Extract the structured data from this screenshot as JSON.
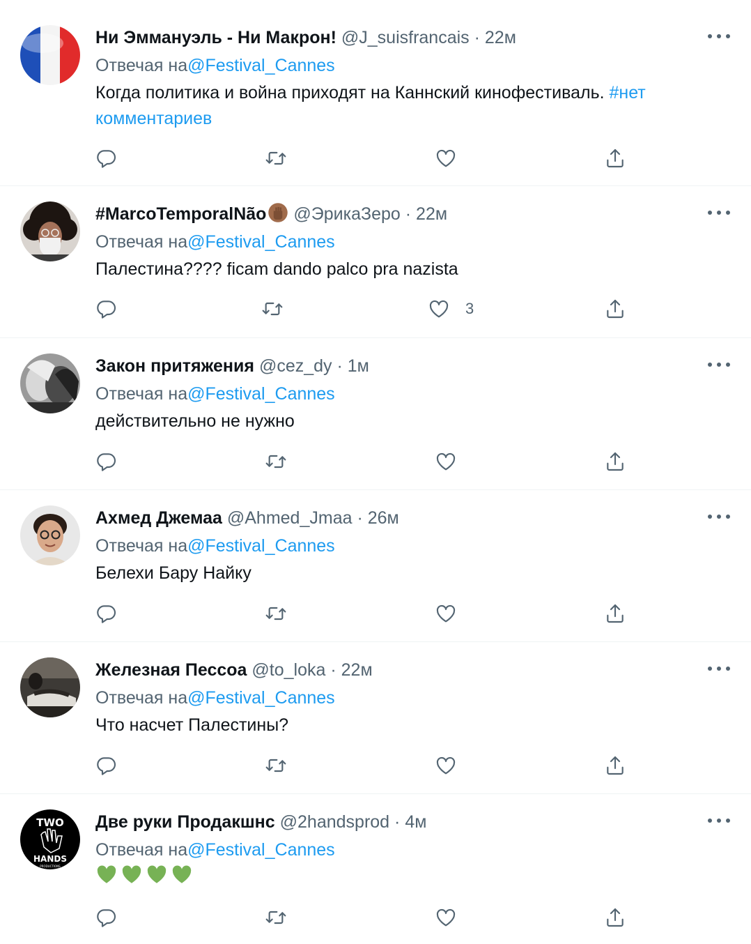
{
  "colors": {
    "link": "#1d9bf0",
    "muted": "#536471",
    "text": "#0f1419",
    "divider": "#eff3f4"
  },
  "replying_prefix": "Отвечая на",
  "tweets": [
    {
      "name": "Ни Эммануэль - Ни Макрон!",
      "handle": "@J_suisfrancais",
      "dot": "·",
      "time": "22м",
      "reply_to": "@Festival_Cannes",
      "text": "Когда политика и война приходят на Каннский кинофестиваль. ",
      "hashtag": "#нет комментариев",
      "avatar": "french-flag",
      "likes": ""
    },
    {
      "name": "#MarcoTemporalNão",
      "name_emoji": "raised-fist-icon",
      "handle": "@ЭрикаЗеро",
      "dot": "·",
      "time": "22м",
      "reply_to": "@Festival_Cannes",
      "text": "Палестина???? ficam dando palco pra nazista",
      "avatar": "person-curly-hair-mask",
      "likes": "3"
    },
    {
      "name": "Закон притяжения",
      "handle": "@cez_dy",
      "dot": "·",
      "time": "1м",
      "reply_to": "@Festival_Cannes",
      "text": "действительно не нужно",
      "avatar": "couple-bw-photo",
      "likes": ""
    },
    {
      "name": "Ахмед Джемаа",
      "handle": "@Ahmed_Jmaa",
      "dot": "·",
      "time": "26м",
      "reply_to": "@Festival_Cannes",
      "text": "Белехи Бару Найку",
      "avatar": "man-glasses",
      "likes": ""
    },
    {
      "name": "Железная Пессоа",
      "handle": "@to_loka",
      "dot": "·",
      "time": "22м",
      "reply_to": "@Festival_Cannes",
      "text": "Что насчет Палестины?",
      "avatar": "dark-scene-photo",
      "likes": ""
    },
    {
      "name": "Две руки Продакшнс",
      "handle": "@2handsprod",
      "dot": "·",
      "time": "4м",
      "reply_to": "@Festival_Cannes",
      "text_emoji": [
        "green-heart-icon",
        "green-heart-icon",
        "green-heart-icon",
        "green-heart-icon"
      ],
      "avatar": "two-hands-logo",
      "avatar_logo_text": "TWO HANDS PRODUCTIONS",
      "likes": ""
    }
  ]
}
